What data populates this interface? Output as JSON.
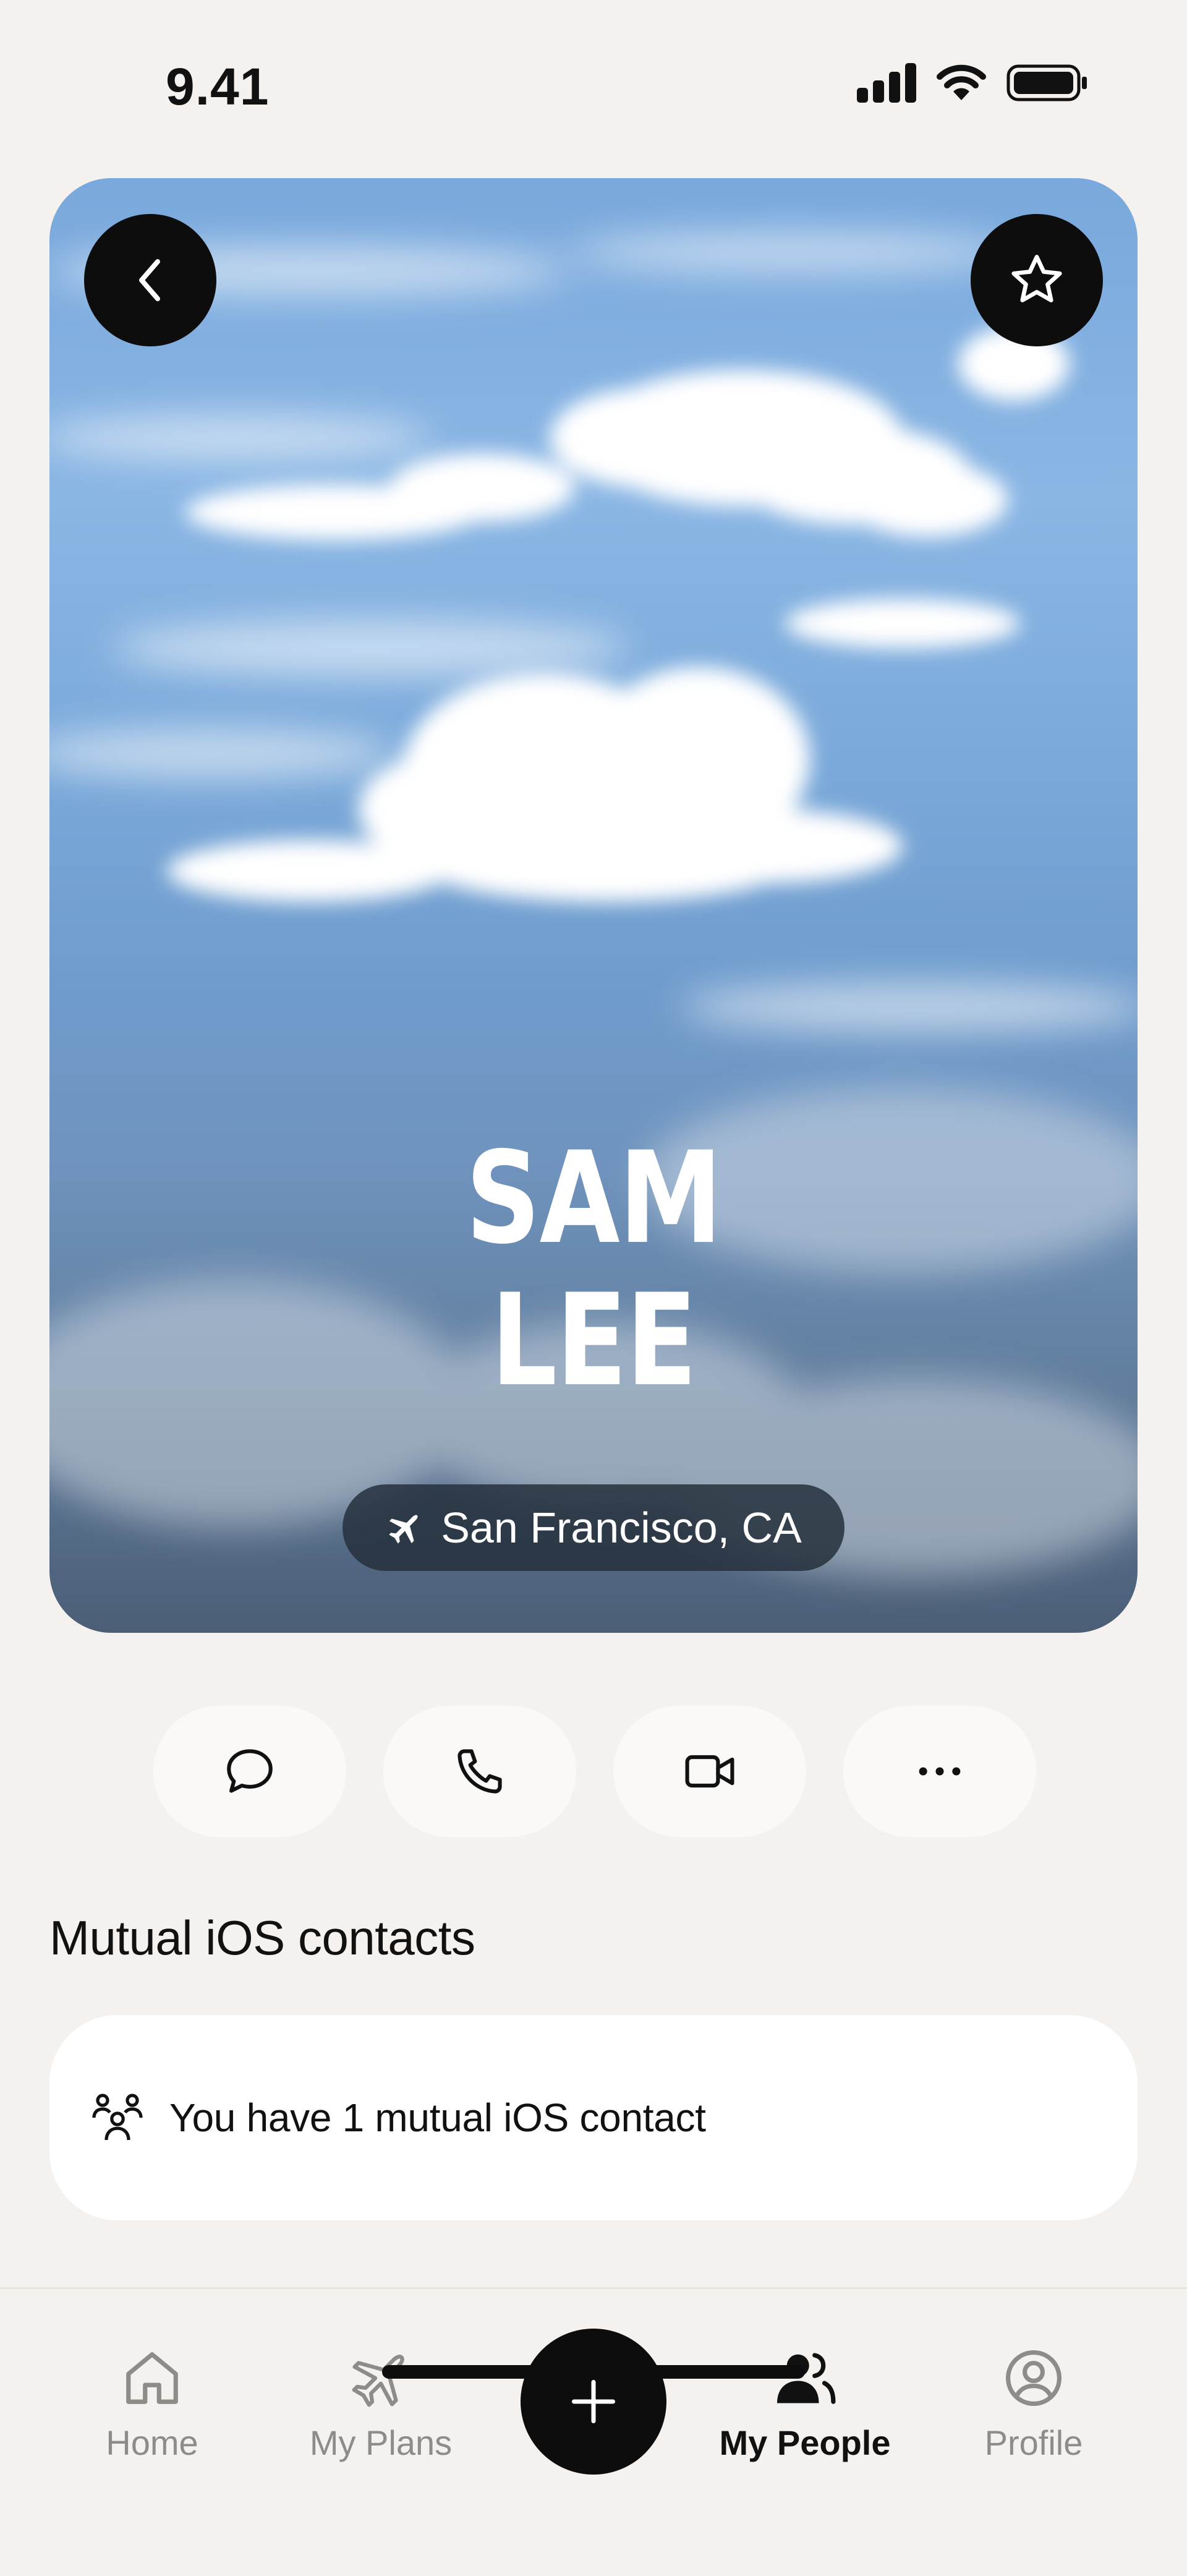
{
  "status_bar": {
    "time": "9.41"
  },
  "profile": {
    "first_name": "SAM",
    "last_name": "LEE",
    "location": "San Francisco, CA"
  },
  "actions": [
    {
      "icon": "message-icon"
    },
    {
      "icon": "phone-icon"
    },
    {
      "icon": "video-icon"
    },
    {
      "icon": "more-icon"
    }
  ],
  "mutual": {
    "title": "Mutual iOS contacts",
    "text": "You have 1 mutual iOS contact"
  },
  "tab_bar": {
    "tabs": [
      {
        "label": "Home",
        "icon": "home-icon",
        "active": false
      },
      {
        "label": "My Plans",
        "icon": "plane-icon",
        "active": false
      },
      {
        "label": "My People",
        "icon": "people-icon",
        "active": true
      },
      {
        "label": "Profile",
        "icon": "profile-icon",
        "active": false
      }
    ]
  },
  "colors": {
    "background": "#f4f1ee",
    "button_dark": "#0d0d0d",
    "pill_bg": "#26303c",
    "tab_inactive": "#8e8b88"
  }
}
